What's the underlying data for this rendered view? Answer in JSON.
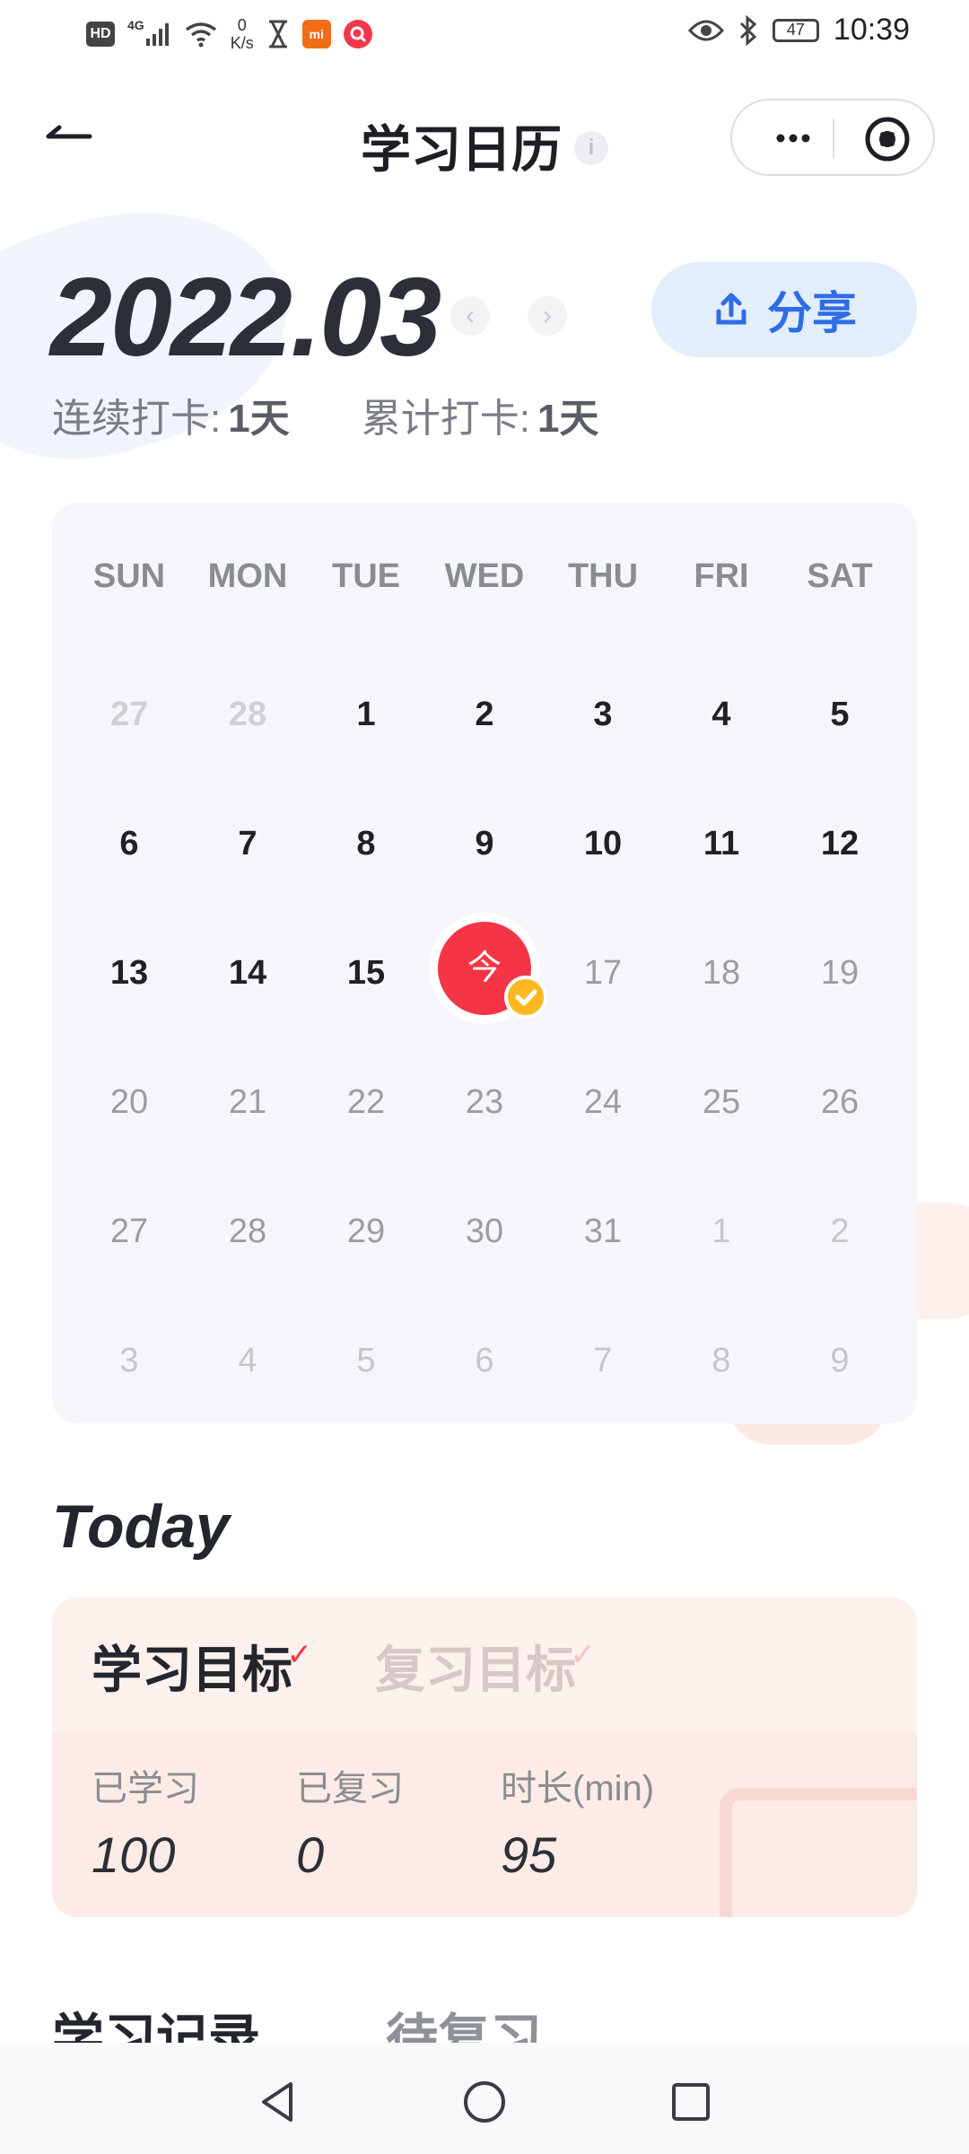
{
  "status_bar": {
    "hd": "HD",
    "network": "4G",
    "speed_value": "0",
    "speed_unit": "K/s",
    "battery": "47",
    "time": "10:39"
  },
  "header": {
    "title": "学习日历",
    "info_icon": "i"
  },
  "calendar": {
    "month": "2022.03",
    "prev_arrow": "‹",
    "next_arrow": "›",
    "share_label": "分享",
    "streak_label": "连续打卡:",
    "streak_value": "1天",
    "total_label": "累计打卡:",
    "total_value": "1天",
    "weekdays": [
      "SUN",
      "MON",
      "TUE",
      "WED",
      "THU",
      "FRI",
      "SAT"
    ],
    "weeks": [
      [
        "27",
        "28",
        "1",
        "2",
        "3",
        "4",
        "5"
      ],
      [
        "6",
        "7",
        "8",
        "9",
        "10",
        "11",
        "12"
      ],
      [
        "13",
        "14",
        "15",
        "今",
        "17",
        "18",
        "19"
      ],
      [
        "20",
        "21",
        "22",
        "23",
        "24",
        "25",
        "26"
      ],
      [
        "27",
        "28",
        "29",
        "30",
        "31",
        "1",
        "2"
      ],
      [
        "3",
        "4",
        "5",
        "6",
        "7",
        "8",
        "9"
      ]
    ]
  },
  "today": {
    "title": "Today",
    "tabs": [
      "学习目标",
      "复习目标"
    ],
    "metrics": [
      {
        "label": "已学习",
        "value": "100"
      },
      {
        "label": "已复习",
        "value": "0"
      },
      {
        "label": "时长(min)",
        "value": "95"
      }
    ]
  },
  "records": {
    "tabs": [
      "学习记录",
      "待复习"
    ]
  },
  "colors": {
    "accent_red": "#f43545",
    "accent_blue": "#2e6de4",
    "check_yellow": "#fbb820"
  }
}
